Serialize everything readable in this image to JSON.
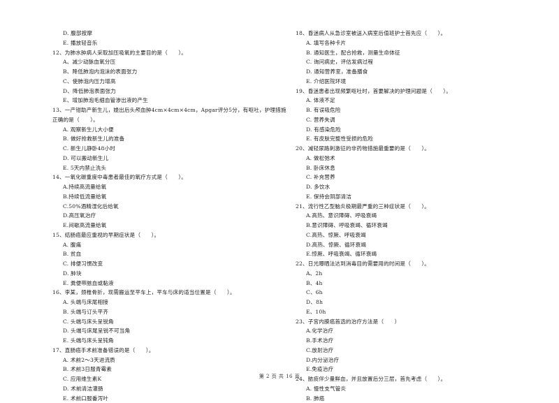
{
  "page": {
    "footer": "第 2 页 共 16 页"
  },
  "left_column": {
    "carryover_options": [
      "D. 腹部按摩",
      "E. 播放轻音乐"
    ],
    "questions": [
      {
        "number": "12",
        "text": "12、为肺水肿病人采取加压吸氧的主要目的是（　　）。",
        "options": [
          "A、减少动脉血氧分压",
          "B、降低肺泡内泡沫的表面张力",
          "C、使肺泡内压力增高",
          "D、降低肺泡表面张力",
          "E、增加肺泡毛细血管渗出液的产生"
        ]
      },
      {
        "number": "13",
        "text_line1": "13、一产钳助产新生儿，娩出后头颅血肿4cm×4cm×4cm，Apgar评分5分，有呕吐，护理措施",
        "text_line2": "正确的是（　　）。",
        "options": [
          "A. 观察新生儿大小便",
          "B. 做好抢救新生儿的准备",
          "C. 新生儿静卧48小时",
          "D. 可以搬动新生儿",
          "E. 5天内禁止洗头"
        ]
      },
      {
        "number": "14",
        "text": "14、一氧化碳重度中毒患者最佳的氧疗方式是（　　）。",
        "options": [
          "A.持续高流量给氧",
          "B.持续低流量给氧",
          "C.50%酒精湿化后给氧",
          "D.高压氧治疗",
          "E.间歇高流量给氧"
        ]
      },
      {
        "number": "15",
        "text": "15、结肠癌最应重视的早期症状是（　　）。",
        "options": [
          "A. 腹痛",
          "B. 贫血",
          "C. 排便习惯改变",
          "D. 肿块",
          "E. 粪便带脓血或黏液"
        ]
      },
      {
        "number": "16",
        "text": "16、李某，颈椎骨折，现需搬运至平车上，平车与床的适当位置是（　　）。",
        "options": [
          "A. 头端与床尾相接",
          "B. 头端与订头平齐",
          "C. 头端与床头呈锐角",
          "D. 头端与床尾呈锐不可当角",
          "E. 头端与床头呈钝角"
        ]
      },
      {
        "number": "17",
        "text": "17、直肠癌手术前准备错误的是（　　）。",
        "options": [
          "A. 术前2～3天进流质",
          "B. 术前3日服青霉素",
          "C. 应用维生素K",
          "D. 术前清洁灌肠",
          "E. 术前口服番泻叶"
        ]
      }
    ]
  },
  "right_column": {
    "questions": [
      {
        "number": "18",
        "text": "18、昏迷病人从急诊室被送入病室后值班护士首先应（　　）。",
        "options": [
          "A. 填写各种卡片",
          "B. 通知医生，配合抢救，测量生命体征",
          "C. 询问病史，评估发病过程",
          "D. 通知营养室，准备膳食",
          "E. 介绍医院环境"
        ]
      },
      {
        "number": "19",
        "text": "19、昏迷患者出现频繁呕吐时，首要解决的护理问题是（　　）。",
        "options": [
          "A. 体液不足",
          "B. 有误吸危险",
          "C. 营养失调",
          "D. 有感染危险",
          "E. 有皮肤完整性受损的危险"
        ]
      },
      {
        "number": "20",
        "text": "20、减轻尿路刺激征的非药物措施最重要的是（　　）。",
        "options": [
          "A. 做松弛术",
          "B. 卧床休息",
          "C. 补充营养",
          "D. 多饮水",
          "E. 保持会阴部清洁"
        ]
      },
      {
        "number": "21",
        "text": "21、流行性乙型脑炎极期最严重的三种症状是（　　）。",
        "options": [
          "A.高热、意识障碍、呼吸衰竭",
          "B.意识障碍、呼吸衰竭、循环衰竭",
          "C.高热、惊厥、呼吸衰竭",
          "D.高热、惊厥、循环衰竭",
          "E.惊厥、呼吸衰竭、循环衰竭"
        ]
      },
      {
        "number": "22",
        "text": "22、日光曝晒法达到消毒目的需要用的时间是（　　）。",
        "options": [
          "A、2h",
          "B、4h",
          "C、6h",
          "D、8h",
          "E、10h"
        ]
      },
      {
        "number": "23",
        "text": "23、子宫内膜癌首选的治疗方法是（　　）",
        "options": [
          "A.化学治疗",
          "B.手术治疗",
          "C.放射治疗",
          "D.内分泌治疗",
          "E.免疫治疗"
        ]
      },
      {
        "number": "24",
        "text": "24、脓痰伴少量鲜血，并且放置后分三层，首先考虑（　　）。",
        "options": [
          "A. 慢性支气管炎",
          "B. 肺癌"
        ]
      }
    ]
  }
}
